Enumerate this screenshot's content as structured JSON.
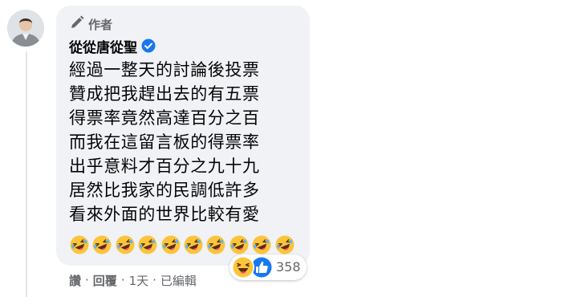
{
  "comment": {
    "author_badge": "作者",
    "author_name": "從從唐從聖",
    "text_lines": [
      "經過一整天的討論後投票",
      "贊成把我趕出去的有五票",
      "得票率竟然高達百分之百",
      "而我在這留言板的得票率",
      "出乎意料才百分之九十九",
      "居然比我家的民調低許多",
      "看來外面的世界比較有愛"
    ],
    "emoji_row": "🤣🤣🤣🤣🤣🤣🤣🤣🤣🤣",
    "emoji_icon": "rolling-on-floor-laughing"
  },
  "reactions": {
    "types": [
      "haha",
      "like"
    ],
    "count": "358"
  },
  "actions": {
    "like": "讚",
    "reply": "回覆",
    "time": "1天",
    "edited": "已編輯",
    "separator": "·"
  }
}
